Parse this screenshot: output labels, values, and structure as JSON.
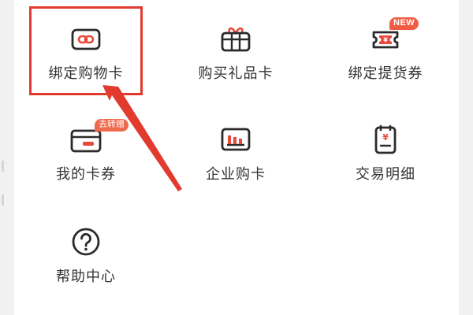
{
  "menu": {
    "items": [
      {
        "id": "bind-card",
        "label": "绑定购物卡",
        "icon": "link-card-icon"
      },
      {
        "id": "buy-gift-card",
        "label": "购买礼品卡",
        "icon": "gift-card-icon"
      },
      {
        "id": "bind-voucher",
        "label": "绑定提货券",
        "icon": "voucher-ticket-icon",
        "badge": "NEW"
      },
      {
        "id": "my-cards",
        "label": "我的卡券",
        "icon": "wallet-card-icon",
        "badge": "去转赠"
      },
      {
        "id": "enterprise-buy",
        "label": "企业购卡",
        "icon": "enterprise-card-icon"
      },
      {
        "id": "transactions",
        "label": "交易明细",
        "icon": "receipt-icon"
      },
      {
        "id": "help",
        "label": "帮助中心",
        "icon": "help-question-icon"
      }
    ]
  },
  "annotation": {
    "highlight_target": "绑定购物卡",
    "colors": {
      "highlight": "#e23a2e",
      "icon_accent": "#e8473a",
      "icon_stroke": "#2b2b2b"
    }
  }
}
